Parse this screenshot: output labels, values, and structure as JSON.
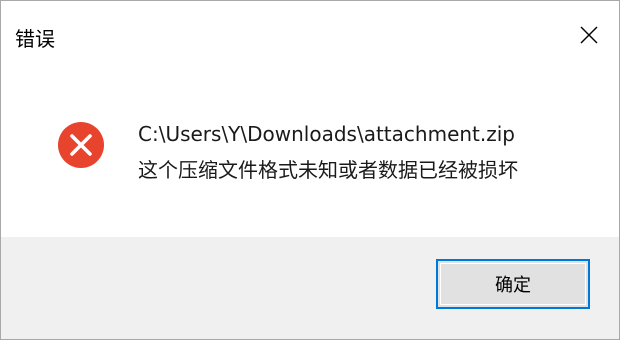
{
  "window": {
    "title": "错误",
    "close_icon": "close-icon"
  },
  "message": {
    "icon": "error-icon",
    "icon_color": "#e8432d",
    "path": "C:\\Users\\Y\\Downloads\\attachment.zip",
    "detail": "这个压缩文件格式未知或者数据已经被损坏"
  },
  "buttons": {
    "ok_label": "确定",
    "accent_color": "#0078d7"
  }
}
